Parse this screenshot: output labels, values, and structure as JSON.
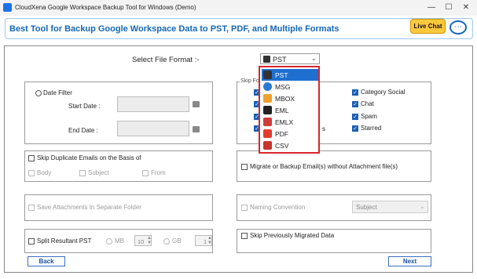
{
  "window": {
    "title": "CloudXena Google Workspace Backup Tool for Windows (Demo)"
  },
  "banner": {
    "text": "Best Tool  for Backup Google Workspace Data to PST, PDF, and Multiple Formats",
    "live_chat_label": "Live Chat"
  },
  "format": {
    "label": "Select File Format :-",
    "selected": "PST",
    "options": [
      {
        "label": "PST",
        "icon": "pst-icon"
      },
      {
        "label": "MSG",
        "icon": "msg-icon"
      },
      {
        "label": "MBOX",
        "icon": "mbox-icon"
      },
      {
        "label": "EML",
        "icon": "eml-icon"
      },
      {
        "label": "EMLX",
        "icon": "emlx-icon"
      },
      {
        "label": "PDF",
        "icon": "pdf-icon"
      },
      {
        "label": "CSV",
        "icon": "csv-icon"
      }
    ]
  },
  "date_filter": {
    "label": "Date Filter",
    "start_label": "Start Date :",
    "end_label": "End Date :"
  },
  "skip_folders": {
    "legend": "Skip Fo",
    "partial_label": "s",
    "items": [
      "Category Social",
      "Chat",
      "Spam",
      "Starred"
    ]
  },
  "skip_duplicates": {
    "label": "Skip Duplicate Emails on the Basis of",
    "body": "Body",
    "subject": "Subject",
    "from": "From"
  },
  "attachments": {
    "without_label": "Migrate or Backup Email(s) without Attachment file(s)",
    "separate_label": "Save Attachments In Separate Folder"
  },
  "naming": {
    "label": "Naming Convention",
    "value": "Subject"
  },
  "split": {
    "label": "Split  Resultant PST",
    "mb_label": "MB",
    "mb_value": "10",
    "gb_label": "GB",
    "gb_value": "1"
  },
  "skip_previous": {
    "label": "Skip Previously Migrated Data"
  },
  "nav": {
    "back": "Back",
    "next": "Next"
  },
  "colors": {
    "accent": "#1468b8",
    "dropdown_border": "#d9262b",
    "selection": "#1f6fd1",
    "live_chat": "#ffc83d"
  }
}
